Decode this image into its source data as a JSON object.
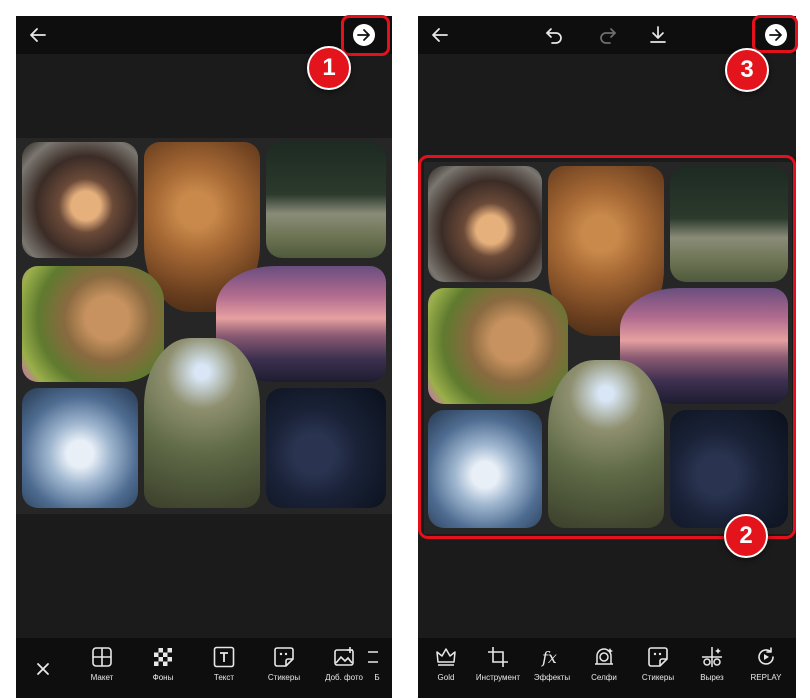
{
  "left_screen": {
    "toolbar": [
      {
        "label": "Макет",
        "icon": "layout-grid-icon"
      },
      {
        "label": "Фоны",
        "icon": "checkerboard-icon"
      },
      {
        "label": "Текст",
        "icon": "text-t-icon"
      },
      {
        "label": "Стикеры",
        "icon": "sticker-icon"
      },
      {
        "label": "Доб. фото",
        "icon": "add-photo-icon"
      },
      {
        "label": "Б",
        "icon": "cutoff-icon"
      }
    ]
  },
  "right_screen": {
    "toolbar": [
      {
        "label": "Gold",
        "icon": "crown-icon"
      },
      {
        "label": "Инструмент",
        "icon": "crop-icon"
      },
      {
        "label": "Эффекты",
        "icon": "fx-icon"
      },
      {
        "label": "Селфи",
        "icon": "selfie-icon"
      },
      {
        "label": "Стикеры",
        "icon": "sticker-icon"
      },
      {
        "label": "Вырез",
        "icon": "cutout-icon"
      },
      {
        "label": "REPLAY",
        "icon": "replay-icon"
      }
    ]
  },
  "steps": [
    "1",
    "2",
    "3"
  ],
  "colors": {
    "highlight": "#e4101c",
    "background": "#1b1b1b",
    "bar": "#0e0e0e"
  }
}
